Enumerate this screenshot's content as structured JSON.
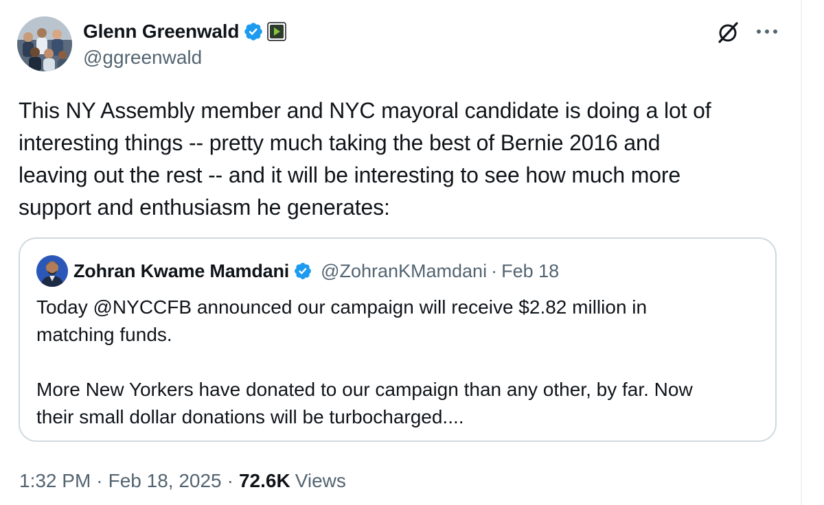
{
  "author": {
    "display_name": "Glenn Greenwald",
    "handle": "@ggreenwald",
    "avatar_icon": "group-photo-avatar",
    "verified_color": "#1d9bf0",
    "affiliate_icon": "rumble-logo-icon"
  },
  "tweet": {
    "text": "This NY Assembly member and NYC mayoral candidate is doing a lot of\ninteresting things -- pretty much taking the best of Bernie 2016 and\nleaving out the rest -- and it will be interesting to see how much more\nsupport and enthusiasm he generates:"
  },
  "quote": {
    "display_name": "Zohran Kwame Mamdani",
    "handle": "@ZohranKMamdani",
    "separator": "·",
    "date": "Feb 18",
    "text": "Today @NYCCFB announced our campaign will receive $2.82 million in\nmatching funds.\n\nMore New Yorkers have donated to our campaign than any other, by far. Now\ntheir small dollar donations will be turbocharged...."
  },
  "meta": {
    "time": "1:32 PM",
    "separator": "·",
    "date": "Feb 18, 2025",
    "views_count": "72.6K",
    "views_label": "Views"
  },
  "colors": {
    "text_primary": "#0f1419",
    "text_secondary": "#536471",
    "border": "#cfd9de",
    "accent": "#1d9bf0"
  }
}
